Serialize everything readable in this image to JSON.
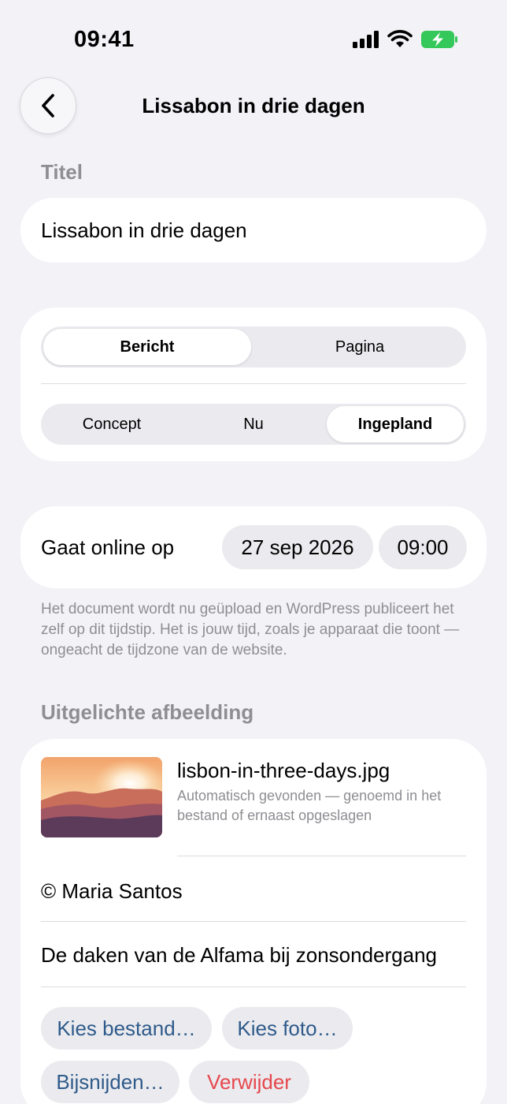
{
  "status": {
    "time": "09:41"
  },
  "nav": {
    "title": "Lissabon in drie dagen"
  },
  "title_section": {
    "label": "Titel",
    "value": "Lissabon in drie dagen"
  },
  "type_segment": {
    "options": [
      "Bericht",
      "Pagina"
    ],
    "selected": "Bericht"
  },
  "publish_segment": {
    "options": [
      "Concept",
      "Nu",
      "Ingepland"
    ],
    "selected": "Ingepland"
  },
  "schedule": {
    "label": "Gaat online op",
    "date": "27 sep 2026",
    "time": "09:00"
  },
  "footnote": "Het document wordt nu geüpload en WordPress publiceert het zelf op dit tijdstip. Het is jouw tijd, zoals je apparaat die toont — ongeacht de tijdzone van de website.",
  "featured_image": {
    "label": "Uitgelichte afbeelding",
    "file_name": "lisbon-in-three-days.jpg",
    "file_sub": "Automatisch gevonden — genoemd in het bestand of ernaast opgeslagen",
    "credit": "© Maria Santos",
    "caption": "De daken van de Alfama bij zonsondergang",
    "buttons": {
      "choose_file": "Kies bestand…",
      "choose_photo": "Kies foto…",
      "crop": "Bijsnijden…",
      "remove": "Verwijder"
    }
  },
  "colors": {
    "background": "#f2f2f7",
    "accent": "#2e5a8a",
    "destructive": "#e5484d",
    "battery": "#34c759"
  }
}
